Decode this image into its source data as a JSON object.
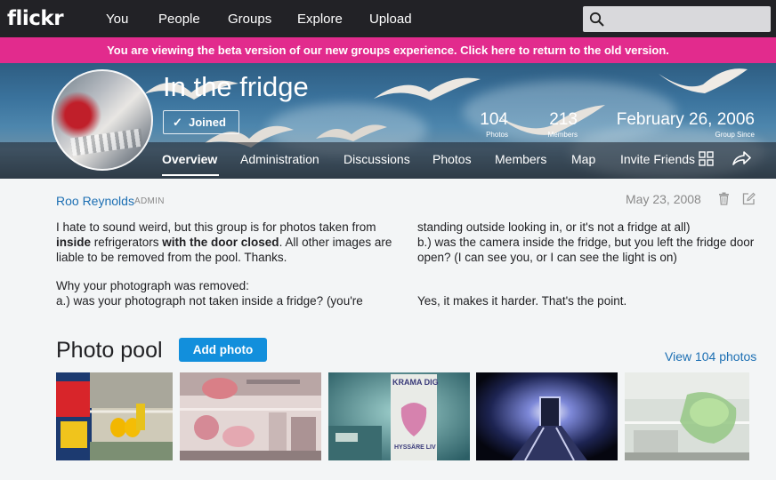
{
  "topnav": {
    "logo": "flickr",
    "links": [
      "You",
      "People",
      "Groups",
      "Explore",
      "Upload"
    ],
    "search_placeholder": ""
  },
  "banner": {
    "text": "You are viewing the beta version of our new groups experience. Click here to return to the old version."
  },
  "group": {
    "title": "In the fridge",
    "joined_label": "Joined",
    "stats": [
      {
        "value": "104",
        "label": "Photos"
      },
      {
        "value": "213",
        "label": "Members"
      },
      {
        "value": "February 26, 2006",
        "label": "Group Since"
      }
    ]
  },
  "subnav": {
    "items": [
      "Overview",
      "Administration",
      "Discussions",
      "Photos",
      "Members",
      "Map",
      "Invite Friends"
    ],
    "active": "Overview"
  },
  "description": {
    "author": "Roo Reynolds",
    "role": "ADMIN",
    "date": "May 23, 2008",
    "intro_1": "I hate to sound weird, but this group is for photos taken from",
    "intro_bold_1": "inside",
    "intro_2": " refrigerators ",
    "intro_bold_2": "with the door closed",
    "intro_3": ". All other images are liable to be removed from the pool. Thanks.",
    "why_1": "Why your photograph was removed:",
    "why_2": "a.) was your photograph not taken inside a fridge? (you're",
    "col2_1": "standing outside looking in, or it's not a fridge at all)",
    "col2_2": "b.) was the camera inside the fridge, but you left the fridge door open? (I can see you, or I can see the light is on)",
    "col2_3": "Yes, it makes it harder. That's the point."
  },
  "pool": {
    "title": "Photo pool",
    "add_label": "Add photo",
    "view_all_label": "View 104 photos",
    "thumb_texts": [
      "KRAMA DIG",
      "HYSSÄRE LIV"
    ]
  },
  "colors": {
    "nav_bg": "#222226",
    "banner_pink": "#e22b8d",
    "link_blue": "#1c6fb3",
    "button_blue": "#128fdc"
  }
}
